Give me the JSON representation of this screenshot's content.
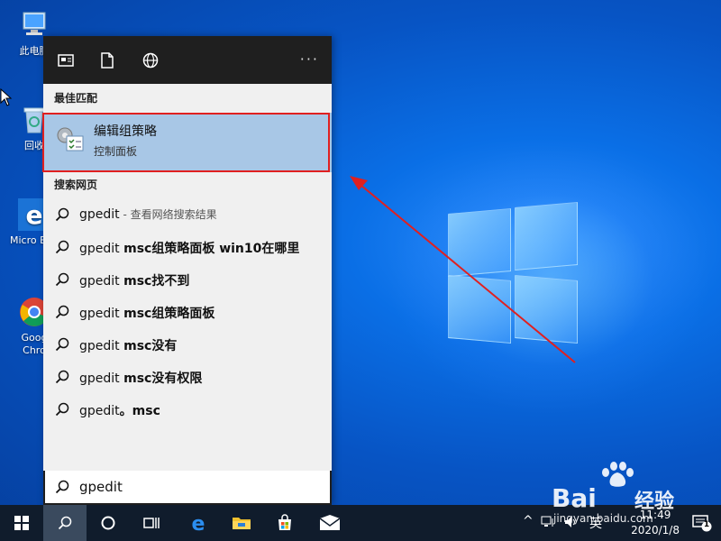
{
  "desktop": {
    "icons": [
      {
        "label": "此电脑",
        "icon": "this-pc-icon"
      },
      {
        "label": "回收",
        "icon": "recycle-bin-icon"
      },
      {
        "label": "Micro Edg",
        "icon": "edge-icon"
      },
      {
        "label": "Goog Chro",
        "icon": "chrome-icon"
      }
    ]
  },
  "search_panel": {
    "top_icons": [
      "news-icon",
      "document-icon",
      "globe-icon"
    ],
    "more_label": "···",
    "best_match_title": "最佳匹配",
    "best_match": {
      "name": "编辑组策略",
      "subtitle": "控制面板",
      "icon": "group-policy-icon"
    },
    "web_title": "搜索网页",
    "suggestions": [
      {
        "prefix": "gpedit",
        "bold": "",
        "hint": " - 查看网络搜索结果"
      },
      {
        "prefix": "gpedit ",
        "bold": "msc组策略面板 win10在哪里",
        "hint": ""
      },
      {
        "prefix": "gpedit ",
        "bold": "msc找不到",
        "hint": ""
      },
      {
        "prefix": "gpedit ",
        "bold": "msc组策略面板",
        "hint": ""
      },
      {
        "prefix": "gpedit ",
        "bold": "msc没有",
        "hint": ""
      },
      {
        "prefix": "gpedit ",
        "bold": "msc没有权限",
        "hint": ""
      },
      {
        "prefix": "gpedit",
        "bold": "。msc",
        "hint": ""
      }
    ],
    "search_value": "gpedit"
  },
  "taskbar": {
    "buttons": [
      "start-icon",
      "search-icon",
      "cortana-icon",
      "task-view-icon",
      "edge-icon",
      "file-explorer-icon",
      "store-icon",
      "mail-icon"
    ],
    "tray": {
      "chevron": "^",
      "ime": "英",
      "time": "11:49",
      "date": "2020/1/8",
      "notification_count": "1"
    }
  },
  "watermark": {
    "brand": "Bai",
    "brand2": "经验",
    "url": "jingyan.baidu.com"
  },
  "colors": {
    "accent_red": "#e02020",
    "selection": "#a8c7e6",
    "panel_bg": "#f0f0f0",
    "taskbar": "#101c2c"
  }
}
